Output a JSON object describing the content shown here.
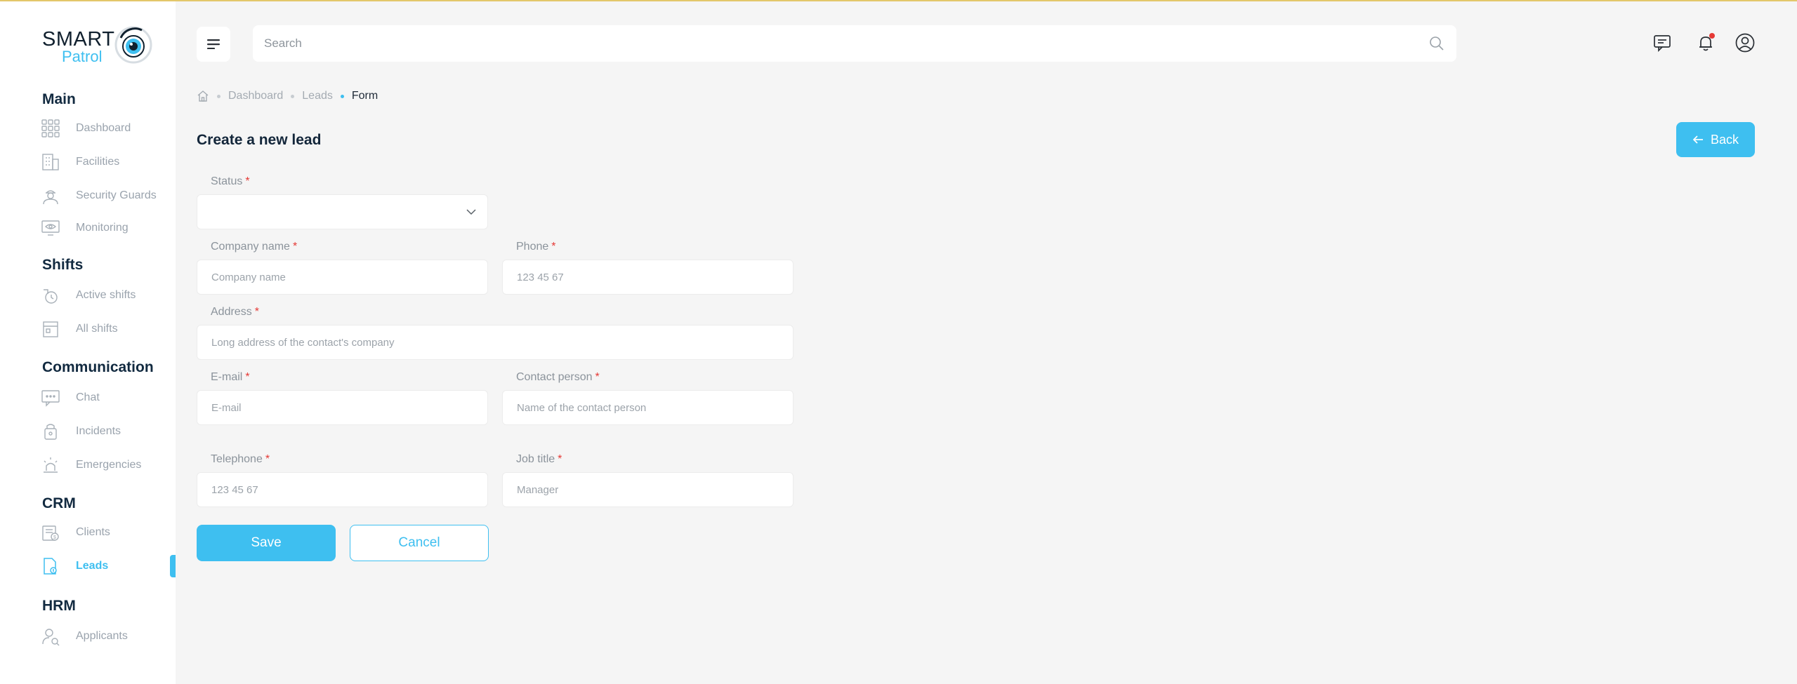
{
  "brand": {
    "line1": "SMART",
    "line2": "Patrol"
  },
  "sidebar": {
    "sections": [
      {
        "title": "Main",
        "items": [
          {
            "label": "Dashboard",
            "icon": "grid-icon"
          },
          {
            "label": "Facilities",
            "icon": "building-icon"
          },
          {
            "label": "Security Guards",
            "icon": "guard-icon"
          },
          {
            "label": "Monitoring",
            "icon": "monitor-eye-icon"
          }
        ]
      },
      {
        "title": "Shifts",
        "items": [
          {
            "label": "Active shifts",
            "icon": "active-shift-icon"
          },
          {
            "label": "All shifts",
            "icon": "calendar-icon"
          }
        ]
      },
      {
        "title": "Communication",
        "items": [
          {
            "label": "Chat",
            "icon": "chat-icon"
          },
          {
            "label": "Incidents",
            "icon": "incident-icon"
          },
          {
            "label": "Emergencies",
            "icon": "alarm-icon"
          }
        ]
      },
      {
        "title": "CRM",
        "items": [
          {
            "label": "Clients",
            "icon": "clients-icon"
          },
          {
            "label": "Leads",
            "icon": "leads-icon",
            "active": true
          }
        ]
      },
      {
        "title": "HRM",
        "items": [
          {
            "label": "Applicants",
            "icon": "applicants-icon"
          }
        ]
      }
    ]
  },
  "search": {
    "placeholder": "Search"
  },
  "breadcrumb": {
    "items": [
      "Dashboard",
      "Leads",
      "Form"
    ]
  },
  "page": {
    "title": "Create a new lead",
    "back_label": "Back"
  },
  "form": {
    "status": {
      "label": "Status",
      "value": ""
    },
    "company_name": {
      "label": "Company name",
      "placeholder": "Company name"
    },
    "phone": {
      "label": "Phone",
      "placeholder": "123 45 67"
    },
    "address": {
      "label": "Address",
      "placeholder": "Long address of the contact's company"
    },
    "email": {
      "label": "E-mail",
      "placeholder": "E-mail"
    },
    "contact_person": {
      "label": "Contact person",
      "placeholder": "Name of the contact person"
    },
    "telephone": {
      "label": "Telephone",
      "placeholder": "123 45 67"
    },
    "job_title": {
      "label": "Job title",
      "placeholder": "Manager"
    },
    "required_mark": "*",
    "save_label": "Save",
    "cancel_label": "Cancel"
  },
  "colors": {
    "accent": "#3ebff0",
    "required": "#e53935",
    "title": "#13263a"
  }
}
